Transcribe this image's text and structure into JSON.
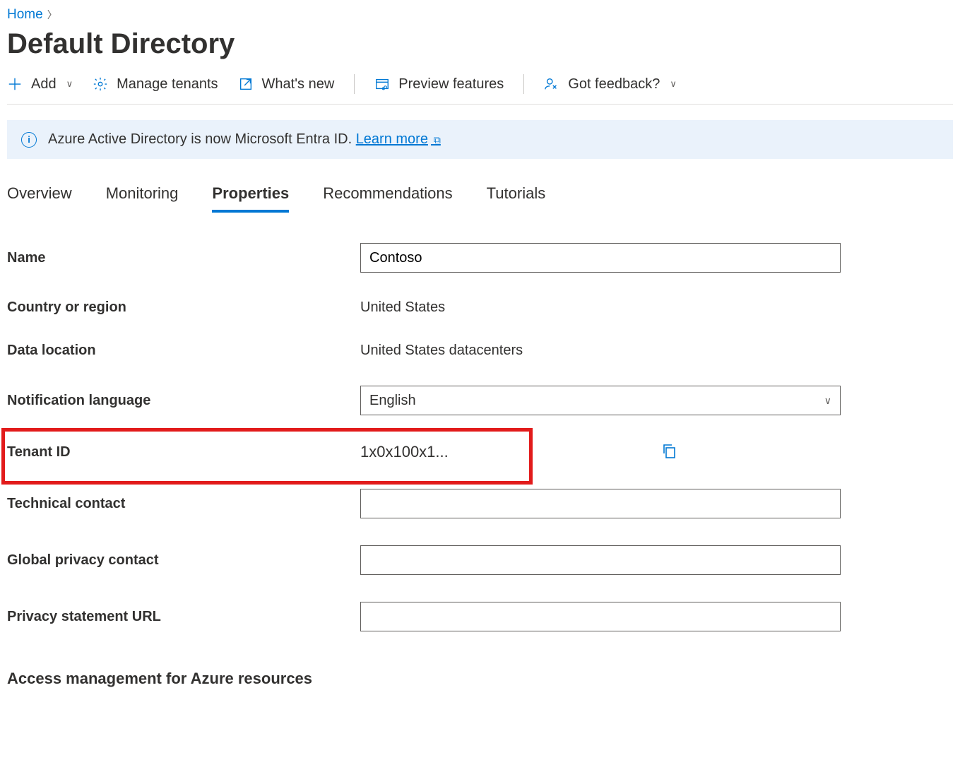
{
  "breadcrumb": {
    "home": "Home"
  },
  "page_title": "Default Directory",
  "toolbar": {
    "add": "Add",
    "manage_tenants": "Manage tenants",
    "whats_new": "What's new",
    "preview_features": "Preview features",
    "got_feedback": "Got feedback?"
  },
  "notification": {
    "text": "Azure Active Directory is now Microsoft Entra ID. ",
    "link": "Learn more"
  },
  "tabs": {
    "overview": "Overview",
    "monitoring": "Monitoring",
    "properties": "Properties",
    "recommendations": "Recommendations",
    "tutorials": "Tutorials"
  },
  "form": {
    "labels": {
      "name": "Name",
      "country": "Country or region",
      "data_location": "Data location",
      "notif_lang": "Notification language",
      "tenant_id": "Tenant ID",
      "tech_contact": "Technical contact",
      "global_privacy": "Global privacy contact",
      "privacy_url": "Privacy statement URL"
    },
    "values": {
      "name": "Contoso",
      "country": "United States",
      "data_location": "United States datacenters",
      "notif_lang": "English",
      "tenant_id": "1x0x100x1...",
      "tech_contact": "",
      "global_privacy": "",
      "privacy_url": ""
    }
  },
  "section_heading": "Access management for Azure resources"
}
